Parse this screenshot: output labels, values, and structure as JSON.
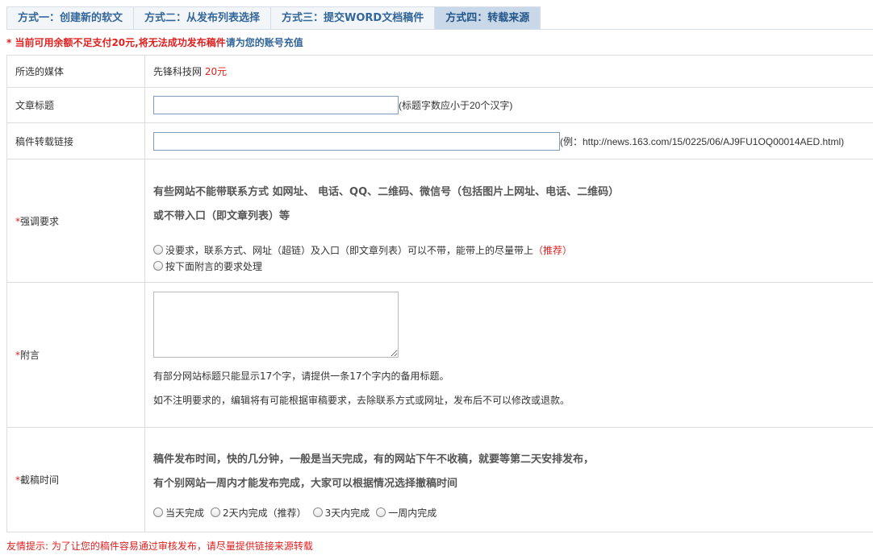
{
  "tabs": [
    {
      "label": "方式一：创建新的软文",
      "active": false
    },
    {
      "label": "方式二：从发布列表选择",
      "active": false
    },
    {
      "label": "方式三：提交WORD文档稿件",
      "active": false
    },
    {
      "label": "方式四：转载来源",
      "active": true
    }
  ],
  "notice": {
    "text": "* 当前可用余额不足支付20元,将无法成功发布稿件",
    "link": "请为您的账号充值"
  },
  "media": {
    "label": "所选的媒体",
    "name": "先锋科技网",
    "price": "20元"
  },
  "title_row": {
    "label": "文章标题",
    "value": "",
    "hint": "(标题字数应小于20个汉字)"
  },
  "link_row": {
    "label": "稿件转载链接",
    "value": "",
    "hint": "(例：http://news.163.com/15/0225/06/AJ9FU1OQ00014AED.html)"
  },
  "emphasis": {
    "required": "*",
    "label": "强调要求",
    "note_line1": "有些网站不能带联系方式 如网址、 电话、QQ、二维码、微信号（包括图片上网址、电话、二维码）",
    "note_line2": "或不带入口（即文章列表）等",
    "option1": "没要求，联系方式、网址（超链）及入口（即文章列表）可以不带，能带上的尽量带上",
    "option1_tag": "（推荐）",
    "option2": "按下面附言的要求处理"
  },
  "postscript": {
    "required": "*",
    "label": "附言",
    "value": "",
    "note1": "有部分网站标题只能显示17个字，请提供一条17个字内的备用标题。",
    "note2": "如不注明要求的，编辑将有可能根据审稿要求，去除联系方式或网址，发布后不可以修改或退款。"
  },
  "deadline": {
    "required": "*",
    "label": "截稿时间",
    "note_line1": "稿件发布时间，快的几分钟，一般是当天完成，有的网站下午不收稿，就要等第二天安排发布，",
    "note_line2": "有个别网站一周内才能发布完成，大家可以根据情况选择撤稿时间",
    "options": [
      "当天完成",
      "2天内完成（推荐）",
      "3天内完成",
      "一周内完成"
    ]
  },
  "footer_tip": "友情提示: 为了让您的稿件容易通过审核发布，请尽量提供链接来源转载"
}
